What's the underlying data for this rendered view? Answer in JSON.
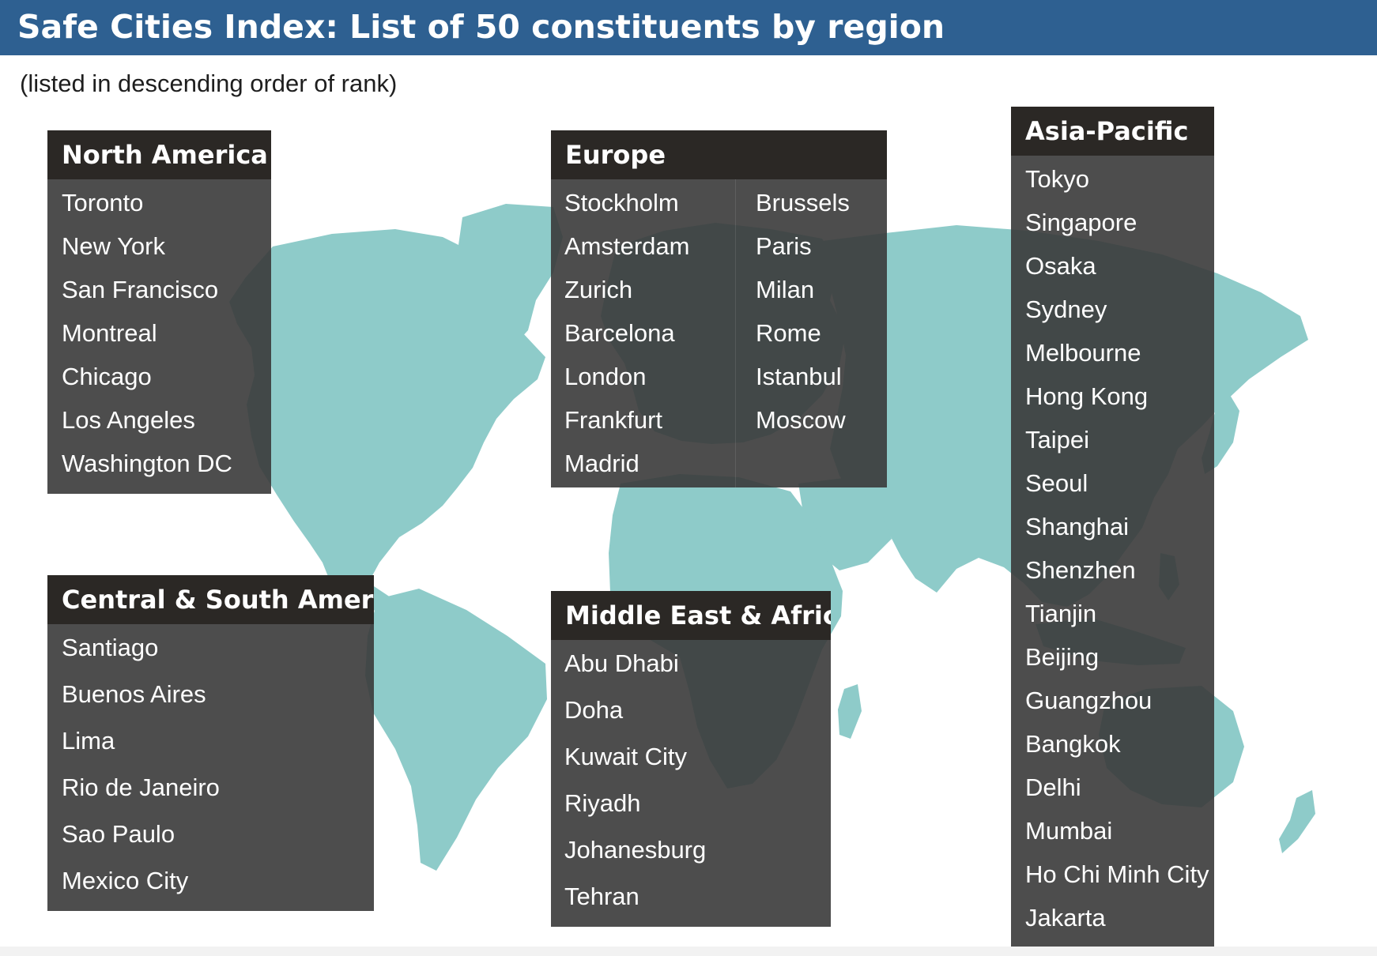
{
  "header": {
    "title": "Safe Cities Index: List of 50 constituents by region",
    "subtitle": "(listed in descending order of rank)"
  },
  "colors": {
    "header_background": "#2e6091",
    "land": "#8ecbc9",
    "panel": "#3a3a3a",
    "panel_header": "#2b2825",
    "text": "#ffffff"
  },
  "regions": [
    {
      "name": "North America",
      "cities": [
        "Toronto",
        "New York",
        "San Francisco",
        "Montreal",
        "Chicago",
        "Los Angeles",
        "Washington DC"
      ]
    },
    {
      "name": "Europe",
      "cities": [
        "Stockholm",
        "Amsterdam",
        "Zurich",
        "Barcelona",
        "London",
        "Frankfurt",
        "Madrid",
        "Brussels",
        "Paris",
        "Milan",
        "Rome",
        "Istanbul",
        "Moscow"
      ]
    },
    {
      "name": "Asia-Pacific",
      "cities": [
        "Tokyo",
        "Singapore",
        "Osaka",
        "Sydney",
        "Melbourne",
        "Hong Kong",
        "Taipei",
        "Seoul",
        "Shanghai",
        "Shenzhen",
        "Tianjin",
        "Beijing",
        "Guangzhou",
        "Bangkok",
        "Delhi",
        "Mumbai",
        "Ho Chi Minh City",
        "Jakarta"
      ]
    },
    {
      "name": "Central & South America",
      "cities": [
        "Santiago",
        "Buenos Aires",
        "Lima",
        "Rio de Janeiro",
        "Sao Paulo",
        "Mexico City"
      ]
    },
    {
      "name": "Middle East & Africa",
      "cities": [
        "Abu Dhabi",
        "Doha",
        "Kuwait City",
        "Riyadh",
        "Johanesburg",
        "Tehran"
      ]
    }
  ]
}
